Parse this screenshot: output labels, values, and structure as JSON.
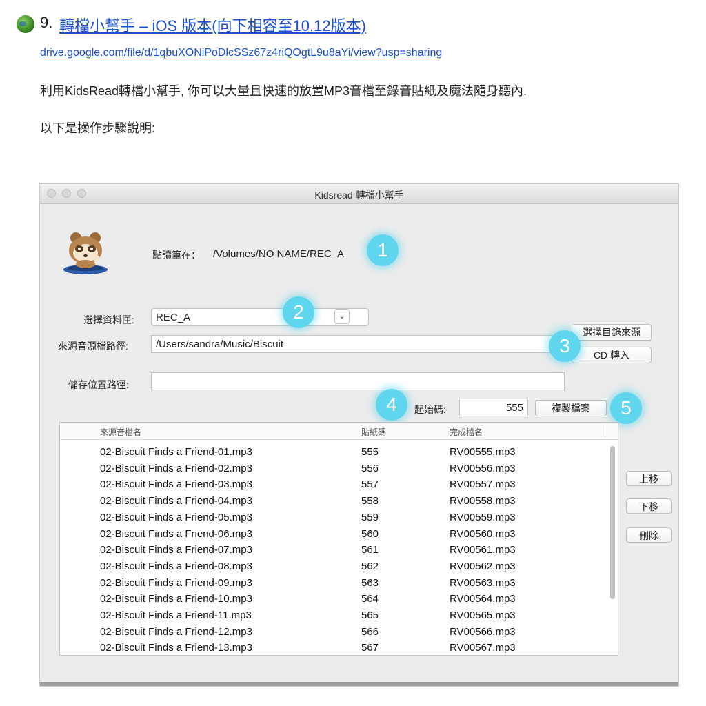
{
  "article": {
    "item_number": "9.",
    "title_link": "轉檔小幫手 – iOS 版本(向下相容至10.12版本)",
    "url": "drive.google.com/file/d/1qbuXONiPoDlcSSz67z4riQOgtL9u8aYi/view?usp=sharing",
    "paragraph1": "利用KidsRead轉檔小幫手, 你可以大量且快速的放置MP3音檔至錄音貼紙及魔法隨身聽內.",
    "paragraph2": "以下是操作步驟說明:"
  },
  "window": {
    "title": "Kidsread 轉檔小幫手",
    "pen_label": "點讀筆在：",
    "pen_path": "/Volumes/NO NAME/REC_A",
    "folder_label": "選擇資料匣:",
    "folder_value": "REC_A",
    "source_label": "來源音源檔路徑:",
    "source_value": "/Users/sandra/Music/Biscuit",
    "save_label": "儲存位置路徑:",
    "save_value": "",
    "choose_dir_button": "選擇目錄來源",
    "cd_button": "CD 轉入",
    "start_code_label": "起始碼:",
    "start_code_value": "555",
    "copy_button": "複製檔案",
    "up_button": "上移",
    "down_button": "下移",
    "delete_button": "刪除",
    "badges": [
      "1",
      "2",
      "3",
      "4",
      "5"
    ]
  },
  "table": {
    "headers": [
      "來源音檔名",
      "貼紙碼",
      "完成檔名"
    ],
    "rows": [
      [
        "02-Biscuit Finds a Friend-01.mp3",
        "555",
        "RV00555.mp3"
      ],
      [
        "02-Biscuit Finds a Friend-02.mp3",
        "556",
        "RV00556.mp3"
      ],
      [
        "02-Biscuit Finds a Friend-03.mp3",
        "557",
        "RV00557.mp3"
      ],
      [
        "02-Biscuit Finds a Friend-04.mp3",
        "558",
        "RV00558.mp3"
      ],
      [
        "02-Biscuit Finds a Friend-05.mp3",
        "559",
        "RV00559.mp3"
      ],
      [
        "02-Biscuit Finds a Friend-06.mp3",
        "560",
        "RV00560.mp3"
      ],
      [
        "02-Biscuit Finds a Friend-07.mp3",
        "561",
        "RV00561.mp3"
      ],
      [
        "02-Biscuit Finds a Friend-08.mp3",
        "562",
        "RV00562.mp3"
      ],
      [
        "02-Biscuit Finds a Friend-09.mp3",
        "563",
        "RV00563.mp3"
      ],
      [
        "02-Biscuit Finds a Friend-10.mp3",
        "564",
        "RV00564.mp3"
      ],
      [
        "02-Biscuit Finds a Friend-11.mp3",
        "565",
        "RV00565.mp3"
      ],
      [
        "02-Biscuit Finds a Friend-12.mp3",
        "566",
        "RV00566.mp3"
      ],
      [
        "02-Biscuit Finds a Friend-13.mp3",
        "567",
        "RV00567.mp3"
      ]
    ]
  },
  "colors": {
    "link": "#1a4fcf",
    "badge": "#5fd6ee"
  },
  "icons": {
    "bullet": "globe-icon",
    "mascot": "raccoon-mascot-icon"
  }
}
